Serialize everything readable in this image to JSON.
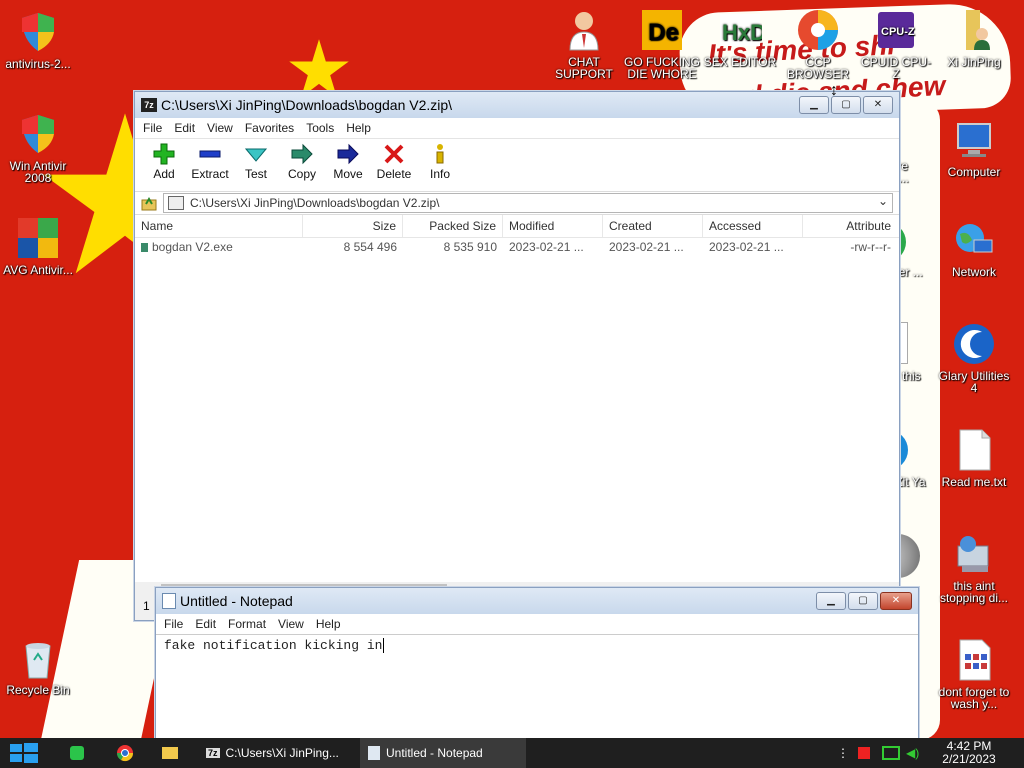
{
  "desktop_icons": [
    {
      "name": "antivirus-icon",
      "label": "antivirus-2..."
    },
    {
      "name": "win-antivirus-icon",
      "label": "Win Antivir 2008"
    },
    {
      "name": "avg-icon",
      "label": "AVG Antivir..."
    },
    {
      "name": "recycle-bin-icon",
      "label": "Recycle Bin"
    },
    {
      "name": "chat-support-icon",
      "label": "CHAT SUPPORT"
    },
    {
      "name": "go-die-icon",
      "label": "GO FUCKING DIE WHORE"
    },
    {
      "name": "sex-editor-icon",
      "label": "SEX EDITOR"
    },
    {
      "name": "ccp-browser-icon",
      "label": "CCP BROWSER"
    },
    {
      "name": "cpuid-icon",
      "label": "CPUID CPU-Z"
    },
    {
      "name": "xi-jinping-icon",
      "label": "Xi JinPing"
    },
    {
      "name": "computer-icon",
      "label": "Computer"
    },
    {
      "name": "network-icon",
      "label": "Network"
    },
    {
      "name": "glary-icon",
      "label": "Glary Utilities 4"
    },
    {
      "name": "readme-icon",
      "label": "Read me.txt"
    },
    {
      "name": "this-aint-icon",
      "label": "this aint stopping di..."
    },
    {
      "name": "dont-forget-icon",
      "label": "dont forget to wash y..."
    },
    {
      "name": "partial-ware-icon",
      "label": "ware ote..."
    },
    {
      "name": "partial-ed-icon",
      "label": "ed er ..."
    },
    {
      "name": "partial-this-icon",
      "label": "this"
    },
    {
      "name": "partial-zit-icon",
      "label": "at Zit Ya"
    }
  ],
  "wallpaper": {
    "text1": "It's time to shi",
    "text2": "and die and chew"
  },
  "zip_window": {
    "title": "C:\\Users\\Xi JinPing\\Downloads\\bogdan V2.zip\\",
    "menu": [
      "File",
      "Edit",
      "View",
      "Favorites",
      "Tools",
      "Help"
    ],
    "toolbar": [
      "Add",
      "Extract",
      "Test",
      "Copy",
      "Move",
      "Delete",
      "Info"
    ],
    "address": "C:\\Users\\Xi JinPing\\Downloads\\bogdan V2.zip\\",
    "columns": [
      "Name",
      "Size",
      "Packed Size",
      "Modified",
      "Created",
      "Accessed",
      "Attribute"
    ],
    "rows": [
      {
        "name": "bogdan V2.exe",
        "size": "8 554 496",
        "packed": "8 535 910",
        "modified": "2023-02-21 ...",
        "created": "2023-02-21 ...",
        "accessed": "2023-02-21 ...",
        "attr": "-rw-r--r-"
      }
    ],
    "status": "1"
  },
  "notepad": {
    "title": "Untitled - Notepad",
    "menu": [
      "File",
      "Edit",
      "Format",
      "View",
      "Help"
    ],
    "content": "fake notification kicking in"
  },
  "taskbar": {
    "task1": "C:\\Users\\Xi JinPing...",
    "task2": "Untitled - Notepad",
    "time": "4:42 PM",
    "date": "2/21/2023"
  }
}
